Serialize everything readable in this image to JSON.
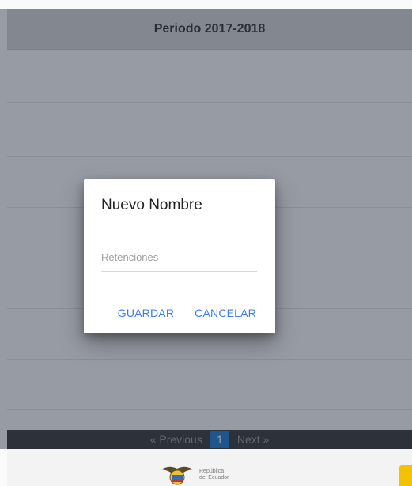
{
  "header": {
    "title": "Periodo 2017-2018"
  },
  "pagination": {
    "previous": "« Previous",
    "current": "1",
    "next": "Next »"
  },
  "footer": {
    "logo_line1": "República",
    "logo_line2": "del Ecuador",
    "logo_icon": "coat-of-arms"
  },
  "dialog": {
    "title": "Nuevo Nombre",
    "input_placeholder": "Retenciones",
    "input_value": "",
    "save_label": "GUARDAR",
    "cancel_label": "CANCELAR"
  },
  "colors": {
    "accent": "#3d7de8",
    "pager_active": "#1f7bd0",
    "brand_yellow": "#f2c200"
  }
}
